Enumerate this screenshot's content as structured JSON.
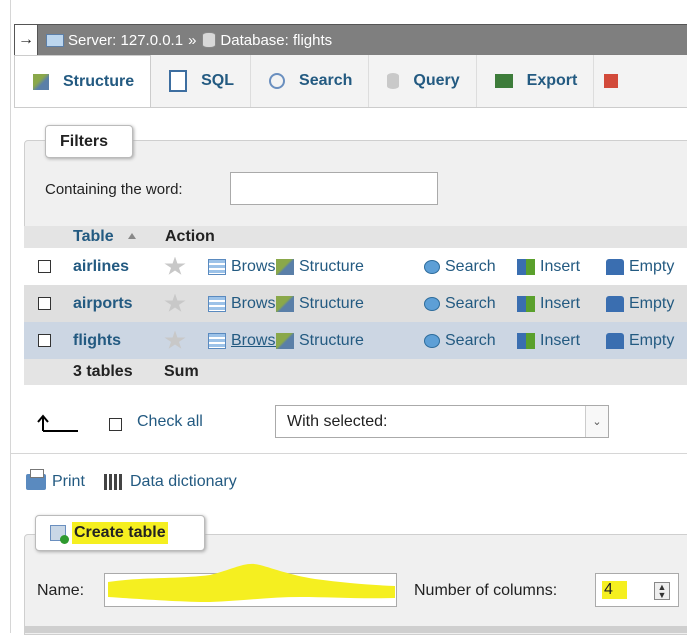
{
  "breadcrumb": {
    "arrow": "→",
    "server": "Server: 127.0.0.1",
    "separator": "»",
    "database": "Database: flights"
  },
  "tabs": [
    {
      "label": "Structure",
      "icon": "structure-icon",
      "active": true
    },
    {
      "label": "SQL",
      "icon": "sql-icon"
    },
    {
      "label": "Search",
      "icon": "search-icon"
    },
    {
      "label": "Query",
      "icon": "query-icon"
    },
    {
      "label": "Export",
      "icon": "export-icon"
    }
  ],
  "filters": {
    "legend": "Filters",
    "label": "Containing the word:",
    "value": ""
  },
  "table": {
    "headers": {
      "table": "Table",
      "action": "Action"
    },
    "actions": {
      "browse": "Browse",
      "structure": "Structure",
      "search": "Search",
      "insert": "Insert",
      "empty": "Empty"
    },
    "rows": [
      {
        "name": "airlines"
      },
      {
        "name": "airports"
      },
      {
        "name": "flights"
      }
    ],
    "footer": {
      "count": "3 tables",
      "sum": "Sum"
    }
  },
  "bulk": {
    "check_all": "Check all",
    "with_selected": "With selected:"
  },
  "links": {
    "print": "Print",
    "data_dictionary": "Data dictionary"
  },
  "create_table": {
    "legend": "Create table",
    "name_label": "Name:",
    "name_value": "",
    "columns_label": "Number of columns:",
    "columns_value": "4"
  },
  "colors": {
    "link": "#235a81",
    "highlight": "#f5ef20",
    "breadcrumb_bg": "#7f7f7f",
    "selected_row": "#ccd6e3"
  }
}
